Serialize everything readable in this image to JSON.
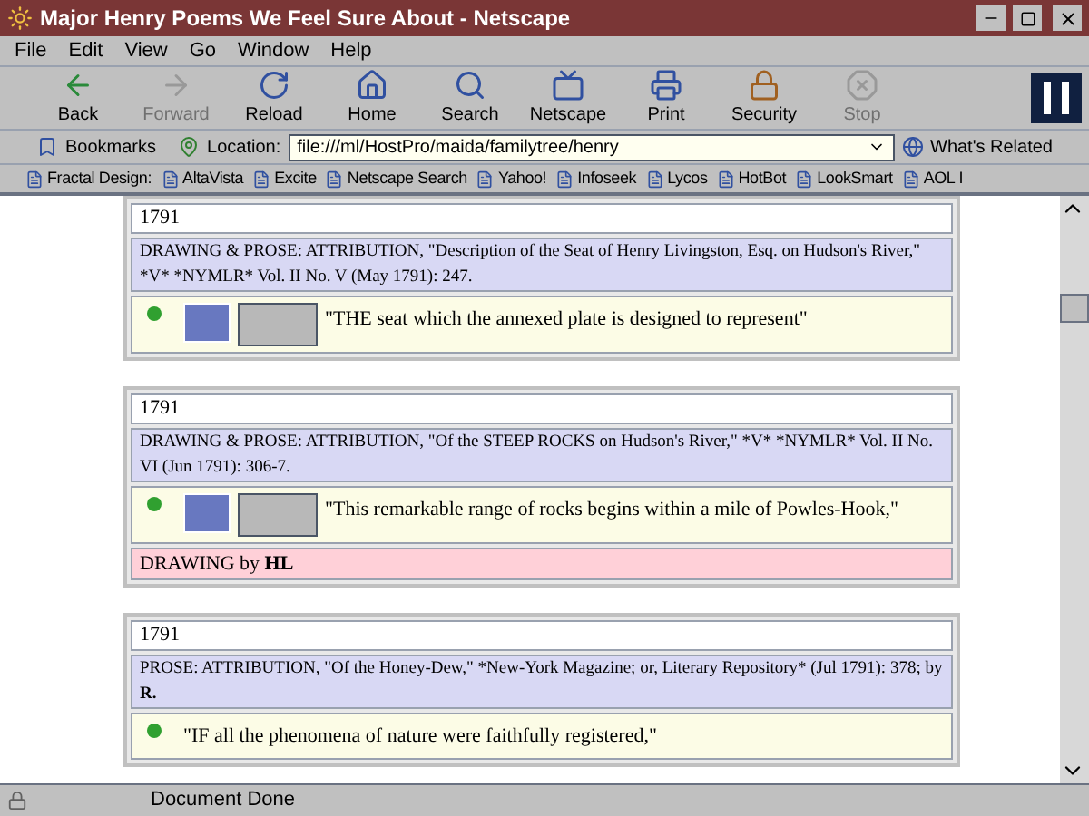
{
  "window": {
    "title": "Major Henry Poems We Feel Sure About - Netscape"
  },
  "menu": [
    "File",
    "Edit",
    "View",
    "Go",
    "Window",
    "Help"
  ],
  "toolbar": [
    {
      "label": "Back",
      "disabled": false,
      "kind": "back"
    },
    {
      "label": "Forward",
      "disabled": true,
      "kind": "forward"
    },
    {
      "label": "Reload",
      "disabled": false,
      "kind": "reload"
    },
    {
      "label": "Home",
      "disabled": false,
      "kind": "home"
    },
    {
      "label": "Search",
      "disabled": false,
      "kind": "search"
    },
    {
      "label": "Netscape",
      "disabled": false,
      "kind": "netscape"
    },
    {
      "label": "Print",
      "disabled": false,
      "kind": "print"
    },
    {
      "label": "Security",
      "disabled": false,
      "kind": "security"
    },
    {
      "label": "Stop",
      "disabled": true,
      "kind": "stop"
    }
  ],
  "location_bar": {
    "bookmarks": "Bookmarks",
    "location_label": "Location:",
    "url": "file:///ml/HostPro/maida/familytree/henry",
    "related": "What's Related"
  },
  "personal_bar": [
    "Fractal Design:",
    "AltaVista",
    "Excite",
    "Netscape Search",
    "Yahoo!",
    "Infoseek",
    "Lycos",
    "HotBot",
    "LookSmart",
    "AOL I"
  ],
  "entries": [
    {
      "year": "1791",
      "citation": "DRAWING & PROSE: ATTRIBUTION, \"Description of the Seat of Henry Livingston, Esq. on Hudson's River,\" *V* *NYMLR* Vol. II No. V (May 1791): 247.",
      "illustrated": true,
      "quote": "\"THE seat which the annexed plate is designed to represent\""
    },
    {
      "year": "1791",
      "citation": "DRAWING & PROSE: ATTRIBUTION, \"Of the STEEP ROCKS on Hudson's River,\" *V* *NYMLR* Vol. II No. VI (Jun 1791): 306-7.",
      "illustrated": true,
      "quote": "\"This remarkable range of rocks begins within a mile of Powles-Hook,\"",
      "credit": "DRAWING by **HL**"
    },
    {
      "year": "1791",
      "citation": "PROSE: ATTRIBUTION, \"Of the Honey-Dew,\" *New-York Magazine; or, Literary Repository* (Jul 1791): 378; by",
      "author": "R.",
      "illustrated": false,
      "quote": "\"IF all the phenomena of nature were faithfully registered,\""
    }
  ],
  "status_bar": {
    "text": "Document Done"
  }
}
